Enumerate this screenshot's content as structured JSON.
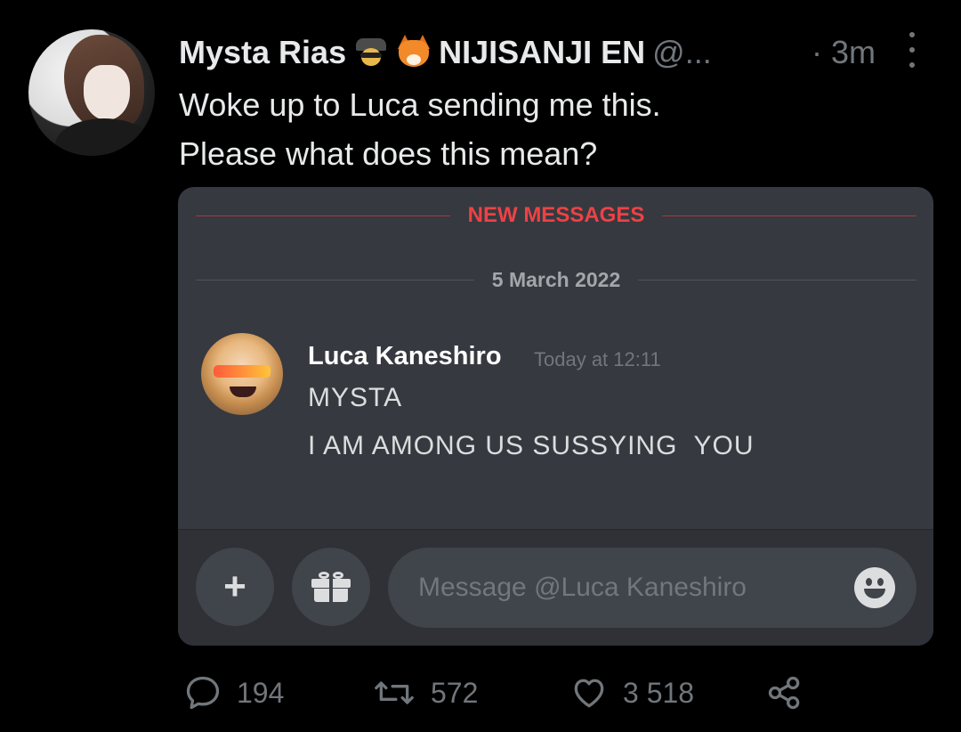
{
  "tweet": {
    "author_name": "Mysta Rias",
    "author_badges": [
      "spy-emoji",
      "fox-emoji"
    ],
    "author_org": "NIJISANJI EN",
    "handle": "@...",
    "time": "· 3m",
    "text_lines": [
      "Woke up to Luca sending me this.",
      "Please what does this mean?"
    ]
  },
  "discord": {
    "new_messages_label": "NEW MESSAGES",
    "date_divider": "5 March 2022",
    "message": {
      "author": "Luca Kaneshiro",
      "timestamp": "Today at 12:11",
      "lines": [
        "MYSTA",
        "I AM AMONG US SUSSYING  YOU"
      ]
    },
    "composer": {
      "plus_label": "+",
      "placeholder": "Message @Luca Kaneshiro"
    },
    "colors": {
      "background": "#36393f",
      "accent_red": "#ed4245"
    }
  },
  "actions": {
    "replies": "194",
    "retweets": "572",
    "likes": "3 518"
  }
}
